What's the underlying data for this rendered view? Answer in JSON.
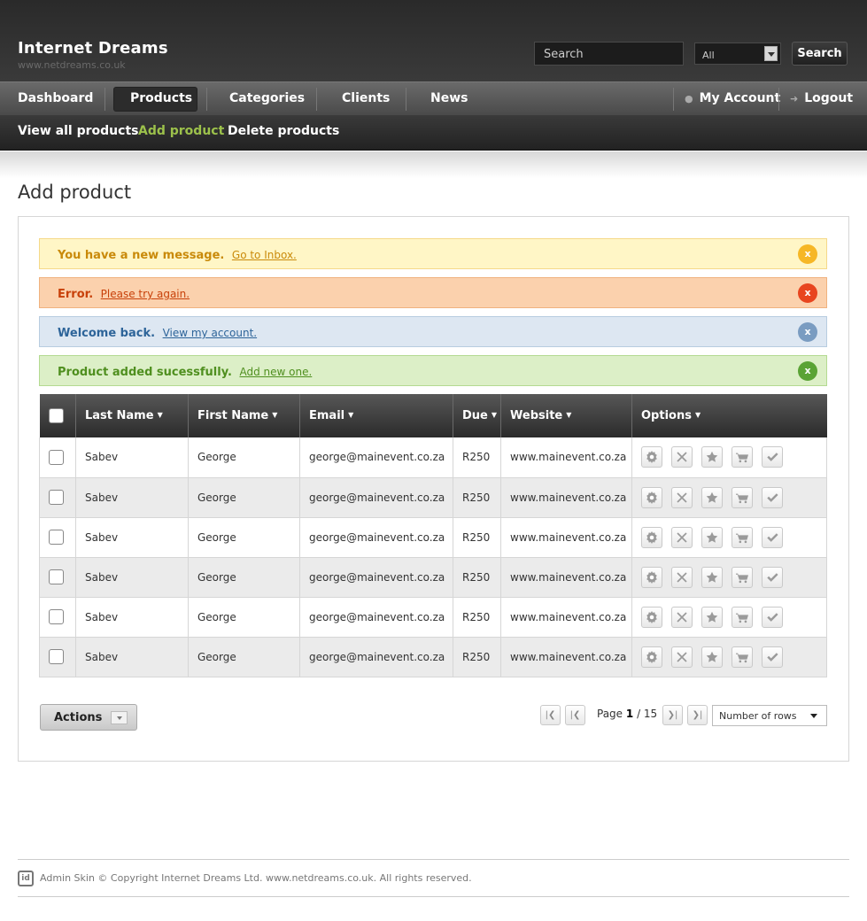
{
  "header": {
    "brand_title": "Internet Dreams",
    "brand_subtitle": "www.netdreams.co.uk",
    "search_placeholder": "Search",
    "search_scope": "All",
    "search_button": "Search"
  },
  "mainnav": {
    "items": [
      "Dashboard",
      "Products",
      "Categories",
      "Clients",
      "News"
    ],
    "active": "Products",
    "my_account": "My Account",
    "logout": "Logout"
  },
  "subnav": {
    "items": [
      "View all products",
      "Add product",
      "Delete products"
    ],
    "active": "Add product"
  },
  "page_title": "Add product",
  "messages": {
    "info": {
      "text": "You have a new message.",
      "link": "Go to Inbox."
    },
    "error": {
      "text": "Error.",
      "link": "Please try again."
    },
    "welcome": {
      "text": "Welcome back.",
      "link": "View my account."
    },
    "success": {
      "text": "Product added sucessfully.",
      "link": "Add new one."
    },
    "close_glyph": "x"
  },
  "table": {
    "columns": [
      "Last Name",
      "First Name",
      "Email",
      "Due",
      "Website",
      "Options"
    ],
    "rows": [
      {
        "last": "Sabev",
        "first": "George",
        "email": "george@mainevent.co.za",
        "due": "R250",
        "website": "www.mainevent.co.za"
      },
      {
        "last": "Sabev",
        "first": "George",
        "email": "george@mainevent.co.za",
        "due": "R250",
        "website": "www.mainevent.co.za"
      },
      {
        "last": "Sabev",
        "first": "George",
        "email": "george@mainevent.co.za",
        "due": "R250",
        "website": "www.mainevent.co.za"
      },
      {
        "last": "Sabev",
        "first": "George",
        "email": "george@mainevent.co.za",
        "due": "R250",
        "website": "www.mainevent.co.za"
      },
      {
        "last": "Sabev",
        "first": "George",
        "email": "george@mainevent.co.za",
        "due": "R250",
        "website": "www.mainevent.co.za"
      },
      {
        "last": "Sabev",
        "first": "George",
        "email": "george@mainevent.co.za",
        "due": "R250",
        "website": "www.mainevent.co.za"
      }
    ],
    "option_icons": [
      "gear-icon",
      "delete-icon",
      "star-icon",
      "cart-icon",
      "check-icon"
    ]
  },
  "actions": {
    "label": "Actions"
  },
  "pagination": {
    "page_label": "Page",
    "current": "1",
    "total": "15",
    "rows_label": "Number of rows"
  },
  "footer": {
    "logo": "id",
    "text": "Admin Skin © Copyright Internet Dreams Ltd. www.netdreams.co.uk. All rights reserved."
  }
}
